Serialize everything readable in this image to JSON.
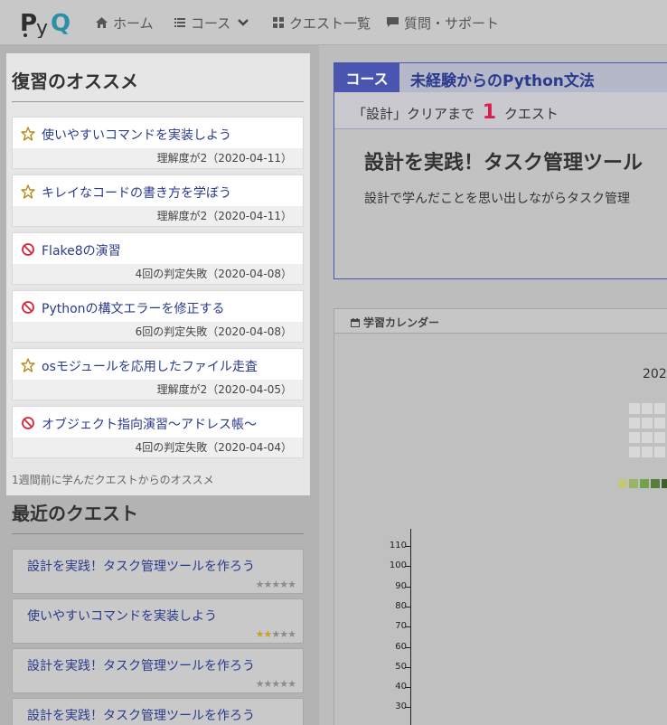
{
  "header": {
    "logo_text": "PyQ",
    "nav": {
      "home": "ホーム",
      "course": "コース",
      "quests": "クエスト一覧",
      "support": "質問・サポート"
    }
  },
  "recommend": {
    "title": "復習のオススメ",
    "items": [
      {
        "icon": "star-icon",
        "title": "使いやすいコマンドを実装しよう",
        "meta": "理解度が2（2020-04-11）"
      },
      {
        "icon": "star-icon",
        "title": "キレイなコードの書き方を学ぼう",
        "meta": "理解度が2（2020-04-11）"
      },
      {
        "icon": "prohibited-icon",
        "title": "Flake8の演習",
        "meta": "4回の判定失敗（2020-04-08）"
      },
      {
        "icon": "prohibited-icon",
        "title": "Pythonの構文エラーを修正する",
        "meta": "6回の判定失敗（2020-04-08）"
      },
      {
        "icon": "star-icon",
        "title": "osモジュールを応用したファイル走査",
        "meta": "理解度が2（2020-04-05）"
      },
      {
        "icon": "prohibited-icon",
        "title": "オブジェクト指向演習〜アドレス帳〜",
        "meta": "4回の判定失敗（2020-04-04）"
      }
    ],
    "footnote": "1週間前に学んだクエストからのオススメ"
  },
  "recent": {
    "title": "最近のクエスト",
    "items": [
      {
        "title": "設計を実践！タスク管理ツールを作ろう",
        "rating": 0
      },
      {
        "title": "使いやすいコマンドを実装しよう",
        "rating": 2
      },
      {
        "title": "設計を実践！タスク管理ツールを作ろう",
        "rating": 0
      },
      {
        "title": "設計を実践！タスク管理ツールを作ろう",
        "rating": 0
      }
    ]
  },
  "course": {
    "tag": "コース",
    "name": "未経験からのPython文法",
    "sub_prefix": "「設計」クリアまで",
    "remaining": "1",
    "sub_suffix": "クエスト",
    "quest_title": "設計を実践！タスク管理ツール",
    "quest_desc": "設計で学んだことを思い出しながらタスク管理"
  },
  "calendar": {
    "title": "学習カレンダー",
    "year": "202",
    "legend_colors": [
      "#c2c77c",
      "#9bb567",
      "#74a14e",
      "#577f3a",
      "#3d5f29"
    ]
  },
  "chart_y_ticks": [
    "110",
    "100",
    "90",
    "80",
    "70",
    "60",
    "50",
    "40",
    "30"
  ],
  "colors": {
    "accent": "#4a55b0",
    "link": "#2a3a8c",
    "highlight": "#d61f4e",
    "star": "#c9a227"
  }
}
